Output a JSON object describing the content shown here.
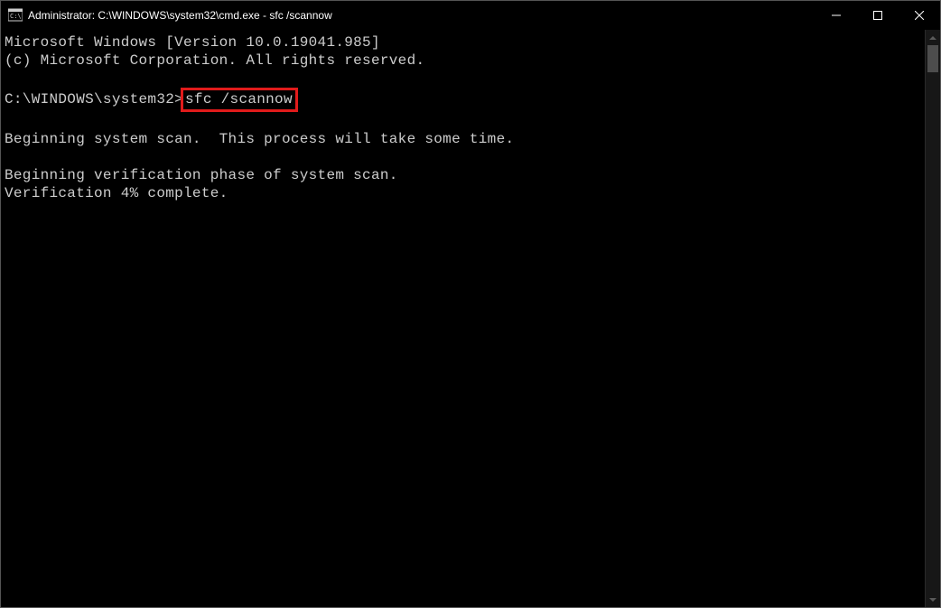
{
  "window": {
    "title": "Administrator: C:\\WINDOWS\\system32\\cmd.exe - sfc  /scannow"
  },
  "terminal": {
    "line1": "Microsoft Windows [Version 10.0.19041.985]",
    "line2": "(c) Microsoft Corporation. All rights reserved.",
    "prompt": "C:\\WINDOWS\\system32>",
    "command": "sfc /scannow",
    "scan_start": "Beginning system scan.  This process will take some time.",
    "verify_phase": "Beginning verification phase of system scan.",
    "verify_progress": "Verification 4% complete."
  }
}
